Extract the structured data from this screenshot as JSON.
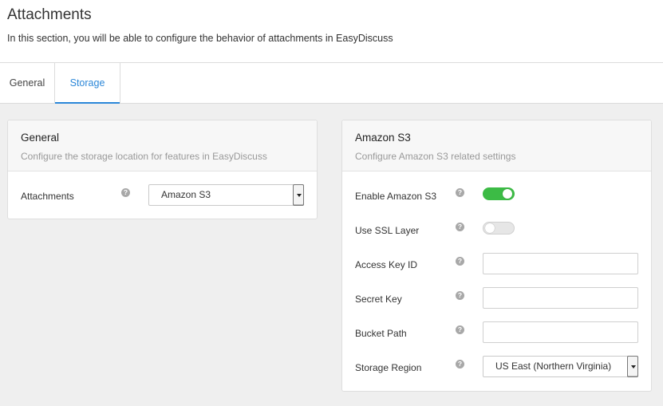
{
  "header": {
    "title": "Attachments",
    "subtitle": "In this section, you will be able to configure the behavior of attachments in EasyDiscuss"
  },
  "tabs": [
    {
      "label": "General",
      "active": false
    },
    {
      "label": "Storage",
      "active": true
    }
  ],
  "general_panel": {
    "title": "General",
    "description": "Configure the storage location for features in EasyDiscuss",
    "attachments_label": "Attachments",
    "attachments_value": "Amazon S3"
  },
  "s3_panel": {
    "title": "Amazon S3",
    "description": "Configure Amazon S3 related settings",
    "enable_label": "Enable Amazon S3",
    "enable_value": true,
    "ssl_label": "Use SSL Layer",
    "ssl_value": false,
    "access_key_label": "Access Key ID",
    "access_key_value": "",
    "secret_key_label": "Secret Key",
    "secret_key_value": "",
    "bucket_label": "Bucket Path",
    "bucket_value": "",
    "region_label": "Storage Region",
    "region_value": "US East (Northern Virginia)"
  },
  "help_glyph": "?",
  "colors": {
    "accent": "#2b87d8",
    "toggle_on": "#3cbb45",
    "page_bg": "#efefef"
  }
}
